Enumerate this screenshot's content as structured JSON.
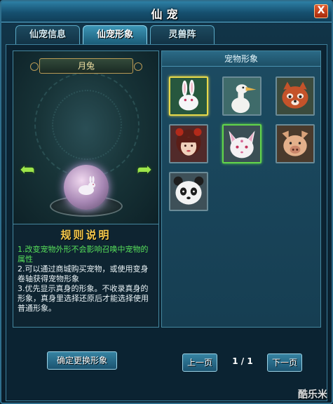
{
  "window": {
    "title": "仙宠",
    "close_label": "X"
  },
  "tabs": [
    {
      "label": "仙宠信息",
      "active": false
    },
    {
      "label": "仙宠形象",
      "active": true
    },
    {
      "label": "灵兽阵",
      "active": false
    }
  ],
  "preview": {
    "pet_name": "月兔",
    "left_arrow_icon": "left-arrow-icon",
    "right_arrow_icon": "right-arrow-icon"
  },
  "rules": {
    "title": "规则说明",
    "items": [
      "1.改变宠物外形不会影响召唤中宠物的属性",
      "2.可以通过商城购买宠物，或使用变身卷轴获得宠物形象",
      "3.优先显示真身的形象。不收录真身的形象，真身里选择还原后才能选择使用普通形象。"
    ]
  },
  "appearance_panel": {
    "header": "宠物形象",
    "slots": [
      {
        "icon": "rabbit-icon",
        "state": "selected"
      },
      {
        "icon": "crane-icon",
        "state": "normal"
      },
      {
        "icon": "red-panda-icon",
        "state": "normal"
      },
      {
        "icon": "girl-icon",
        "state": "normal"
      },
      {
        "icon": "fox-icon",
        "state": "current"
      },
      {
        "icon": "pig-icon",
        "state": "normal"
      },
      {
        "icon": "panda-icon",
        "state": "normal"
      }
    ]
  },
  "controls": {
    "confirm_label": "确定更换形象",
    "prev_label": "上一页",
    "next_label": "下一页",
    "page": "1 / 1"
  },
  "watermark": "酷乐米",
  "colors": {
    "highlight": "#e8d94a",
    "current": "#62d44a",
    "rule_green": "#57e05a",
    "title_gold": "#f5c84c"
  }
}
